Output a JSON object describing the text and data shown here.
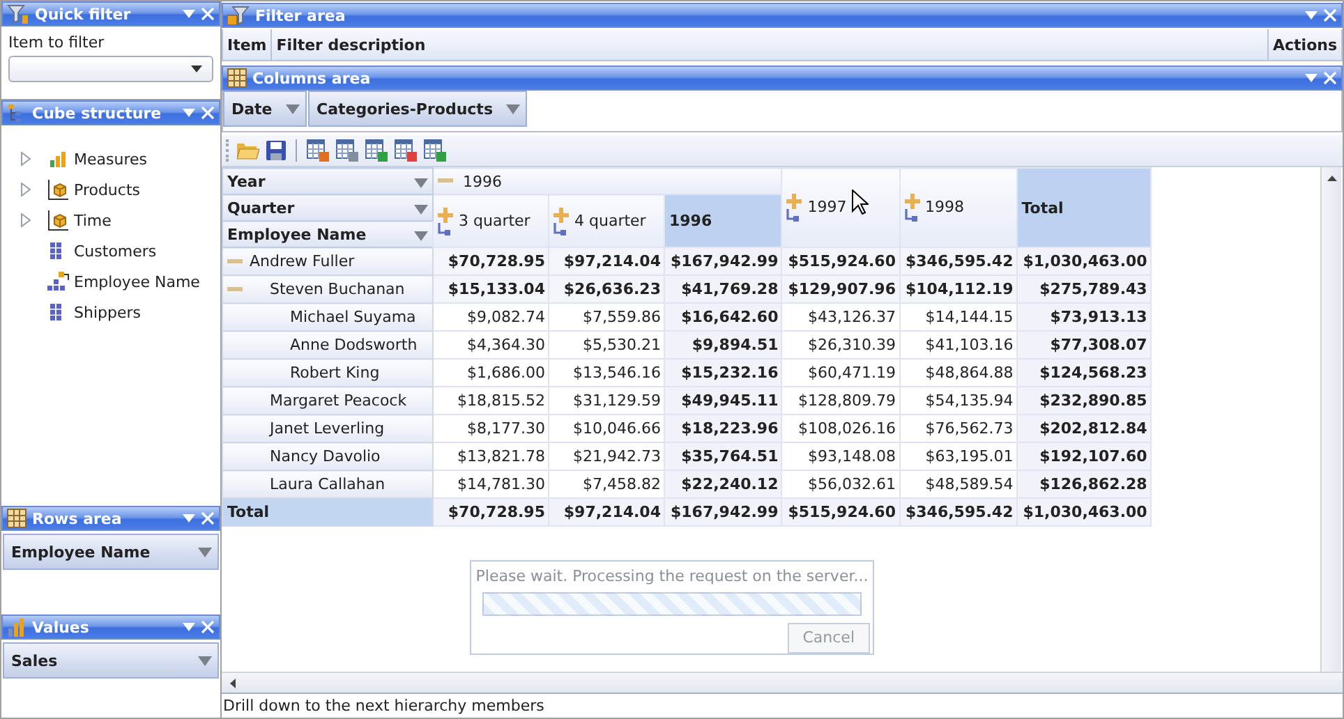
{
  "quick_filter": {
    "title": "Quick filter",
    "label": "Item to filter"
  },
  "cube_structure": {
    "title": "Cube structure",
    "items": [
      {
        "label": "Measures",
        "kind": "measures",
        "expandable": true
      },
      {
        "label": "Products",
        "kind": "cube",
        "expandable": true
      },
      {
        "label": "Time",
        "kind": "cube",
        "expandable": true
      },
      {
        "label": "Customers",
        "kind": "dimension",
        "expandable": false
      },
      {
        "label": "Employee Name",
        "kind": "hierarchy",
        "expandable": false
      },
      {
        "label": "Shippers",
        "kind": "dimension",
        "expandable": false
      }
    ]
  },
  "rows_area": {
    "title": "Rows area",
    "fields": [
      "Employee Name"
    ]
  },
  "values_area": {
    "title": "Values",
    "fields": [
      "Sales"
    ]
  },
  "filter_area": {
    "title": "Filter area",
    "columns": [
      "Item",
      "Filter description",
      "Actions"
    ]
  },
  "columns_area": {
    "title": "Columns area",
    "fields": [
      "Date",
      "Categories-Products"
    ]
  },
  "pivot": {
    "row_fields": [
      "Year",
      "Quarter",
      "Employee Name"
    ],
    "years": [
      {
        "label": "1996",
        "expanded": true,
        "total_label": "1996",
        "children": [
          {
            "label": "3 quarter",
            "expanded": false
          },
          {
            "label": "4 quarter",
            "expanded": false
          }
        ]
      },
      {
        "label": "1997",
        "expanded": false
      },
      {
        "label": "1998",
        "expanded": false
      }
    ],
    "grand_total_label": "Total",
    "rows": [
      {
        "name": "Andrew Fuller",
        "expanded": true,
        "values": [
          "$70,728.95",
          "$97,214.04",
          "$167,942.99",
          "$515,924.60",
          "$346,595.42",
          "$1,030,463.00"
        ],
        "children": [
          {
            "name": "Steven Buchanan",
            "expanded": true,
            "values": [
              "$15,133.04",
              "$26,636.23",
              "$41,769.28",
              "$129,907.96",
              "$104,112.19",
              "$275,789.43"
            ],
            "children": [
              {
                "name": "Michael Suyama",
                "values": [
                  "$9,082.74",
                  "$7,559.86",
                  "$16,642.60",
                  "$43,126.37",
                  "$14,144.15",
                  "$73,913.13"
                ]
              },
              {
                "name": "Anne Dodsworth",
                "values": [
                  "$4,364.30",
                  "$5,530.21",
                  "$9,894.51",
                  "$26,310.39",
                  "$41,103.16",
                  "$77,308.07"
                ]
              },
              {
                "name": "Robert King",
                "values": [
                  "$1,686.00",
                  "$13,546.16",
                  "$15,232.16",
                  "$60,471.19",
                  "$48,864.88",
                  "$124,568.23"
                ]
              }
            ]
          },
          {
            "name": "Margaret Peacock",
            "values": [
              "$18,815.52",
              "$31,129.59",
              "$49,945.11",
              "$128,809.79",
              "$54,135.94",
              "$232,890.85"
            ]
          },
          {
            "name": "Janet Leverling",
            "values": [
              "$8,177.30",
              "$10,046.66",
              "$18,223.96",
              "$108,026.16",
              "$76,562.73",
              "$202,812.84"
            ]
          },
          {
            "name": "Nancy Davolio",
            "values": [
              "$13,821.78",
              "$21,942.73",
              "$35,764.51",
              "$93,148.08",
              "$63,195.01",
              "$192,107.60"
            ]
          },
          {
            "name": "Laura Callahan",
            "values": [
              "$14,781.30",
              "$7,458.82",
              "$22,240.12",
              "$56,032.61",
              "$48,589.54",
              "$126,862.28"
            ]
          }
        ]
      }
    ],
    "total_row": {
      "label": "Total",
      "values": [
        "$70,728.95",
        "$97,214.04",
        "$167,942.99",
        "$515,924.60",
        "$346,595.42",
        "$1,030,463.00"
      ]
    }
  },
  "loading": {
    "message": "Please wait. Processing the request on the server...",
    "button": "Cancel"
  },
  "status_bar": "Drill down to the next hierarchy members"
}
